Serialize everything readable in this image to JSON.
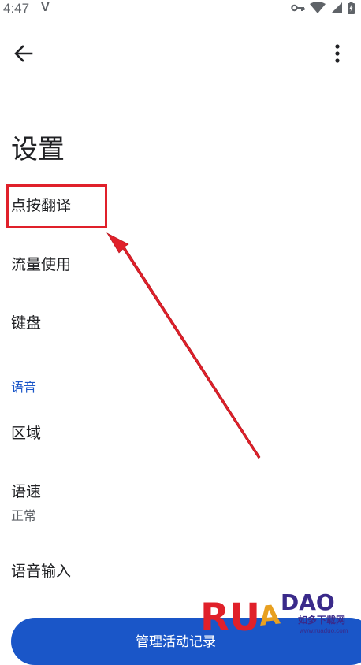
{
  "status_bar": {
    "time": "4:47",
    "indicator": "V"
  },
  "app_bar": {
    "back_icon": "arrow-left-icon",
    "more_icon": "more-vert-icon"
  },
  "page": {
    "title": "设置"
  },
  "items": [
    {
      "label": "点按翻译"
    },
    {
      "label": "流量使用"
    },
    {
      "label": "键盘"
    }
  ],
  "voice_section": {
    "header": "语音",
    "items": [
      {
        "label": "区域"
      },
      {
        "label": "语速",
        "subtitle": "正常"
      },
      {
        "label": "语音输入"
      }
    ]
  },
  "bottom_button": {
    "label": "管理活动记录"
  },
  "watermark": {
    "brand": "RUADAO",
    "subtitle": "如多下载网",
    "url": "www.ruaduo.com"
  },
  "colors": {
    "accent": "#1a56c8",
    "highlight": "#e0202a",
    "text": "#202124"
  }
}
